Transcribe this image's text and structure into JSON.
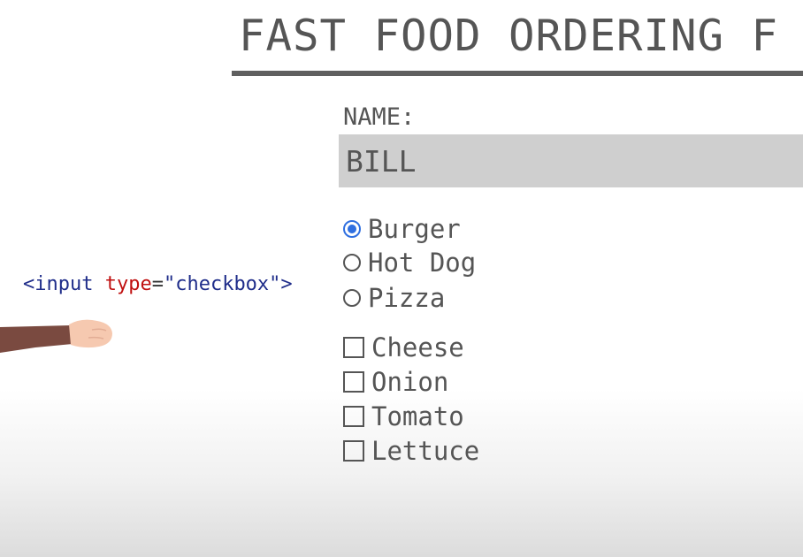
{
  "form": {
    "title": "FAST FOOD ORDERING F",
    "name_label": "NAME:",
    "name_value": "BILL",
    "main_options": [
      {
        "label": "Burger",
        "selected": true
      },
      {
        "label": "Hot Dog",
        "selected": false
      },
      {
        "label": "Pizza",
        "selected": false
      }
    ],
    "toppings": [
      {
        "label": "Cheese",
        "checked": false
      },
      {
        "label": "Onion",
        "checked": false
      },
      {
        "label": "Tomato",
        "checked": false
      },
      {
        "label": "Lettuce",
        "checked": false
      }
    ]
  },
  "annotation": {
    "open_bracket": "<",
    "tag": "input",
    "attr": "type",
    "equals": "=",
    "value": "\"checkbox\"",
    "close_bracket": ">"
  },
  "colors": {
    "radio_selected": "#2f6fe0",
    "input_background": "#cfcfcf",
    "text": "#555555",
    "code_tag": "#1f2d8a",
    "code_attr": "#c01010",
    "arm_sleeve": "#7a4a40",
    "hand_skin": "#f6c9b0"
  }
}
